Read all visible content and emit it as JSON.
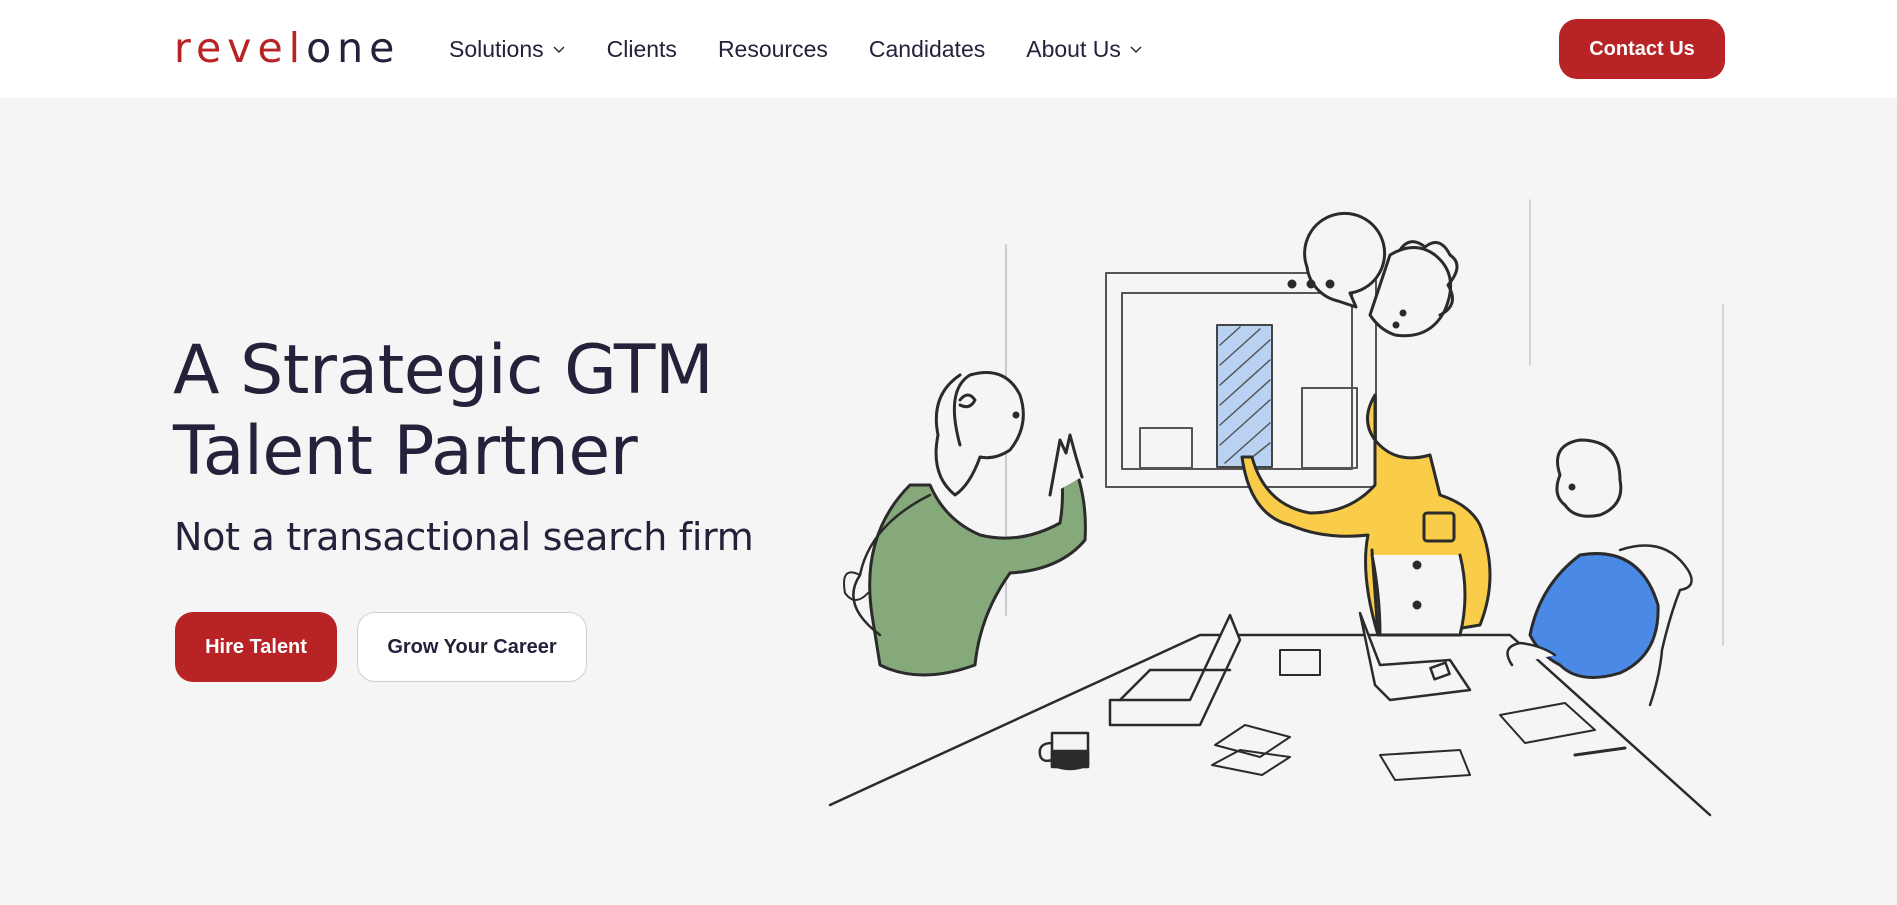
{
  "brand": {
    "logo_part1": "revel",
    "logo_part2": "one",
    "accent_color": "#b82326",
    "text_color": "#23223a"
  },
  "nav": {
    "items": [
      {
        "label": "Solutions",
        "has_dropdown": true,
        "icon": "chevron-down-icon"
      },
      {
        "label": "Clients",
        "has_dropdown": false
      },
      {
        "label": "Resources",
        "has_dropdown": false
      },
      {
        "label": "Candidates",
        "has_dropdown": false
      },
      {
        "label": "About Us",
        "has_dropdown": true,
        "icon": "chevron-down-icon"
      }
    ],
    "contact_label": "Contact Us"
  },
  "hero": {
    "title_line1": "A Strategic GTM",
    "title_line2": "Talent Partner",
    "subtitle": "Not a transactional search firm",
    "primary_cta": "Hire Talent",
    "secondary_cta": "Grow Your Career",
    "illustration": "Sketch illustration of a team meeting: a presenter in a yellow shirt pointing at a bar chart on a whiteboard with a speech bubble, a woman in green waving at a laptop, a man in blue seated at the table",
    "illustration_colors": {
      "yellow": "#f9cd4a",
      "green": "#86a97c",
      "blue": "#4a8ae6",
      "chart_bar": "#b9d2f2"
    }
  }
}
